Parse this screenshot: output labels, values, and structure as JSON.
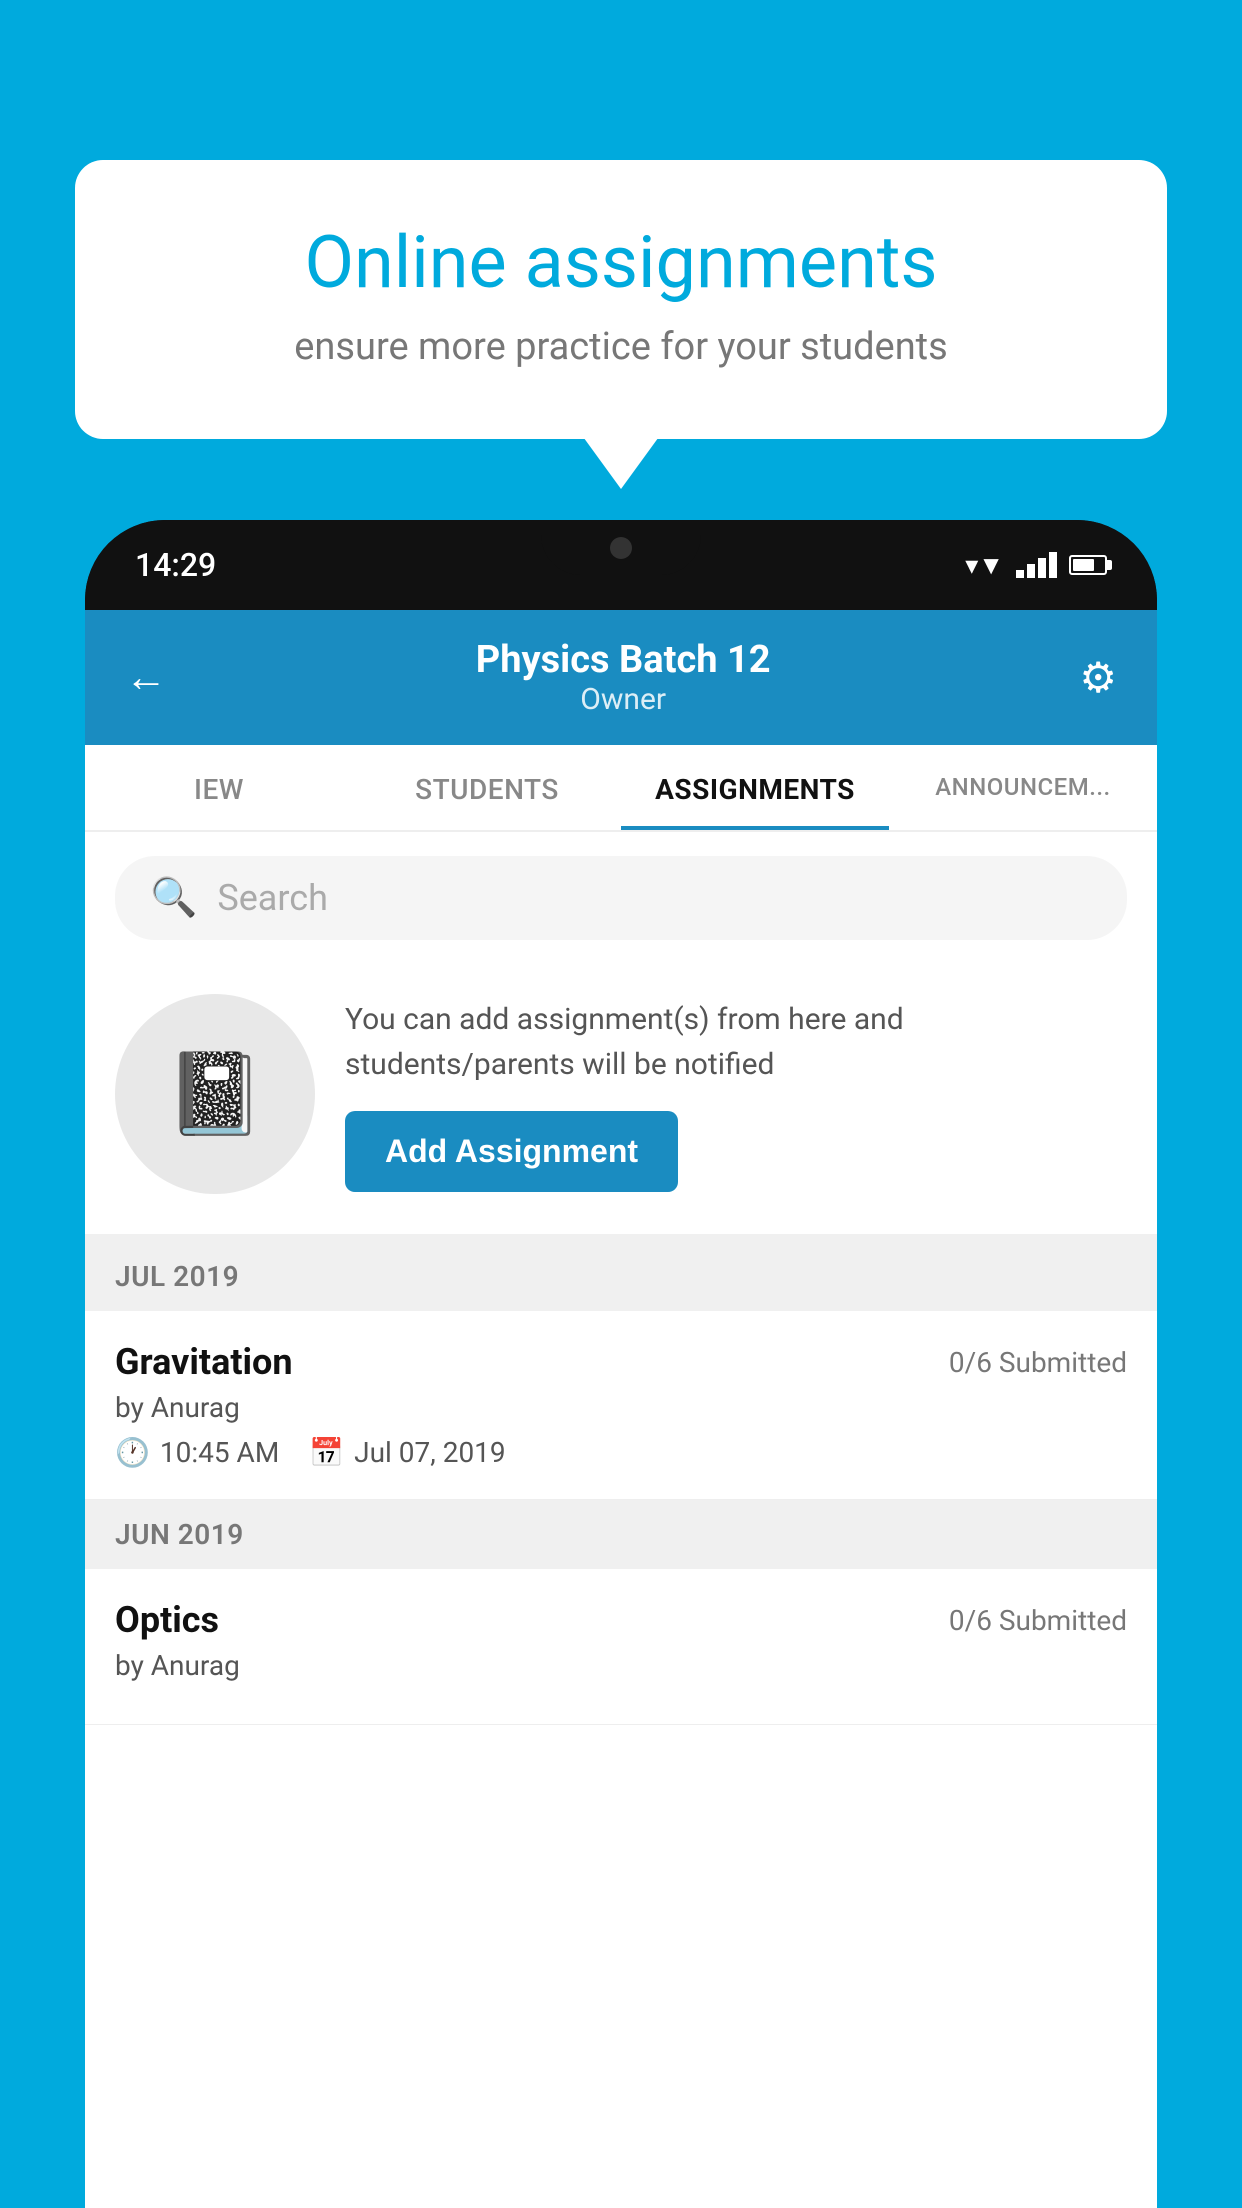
{
  "background_color": "#00AADD",
  "promo": {
    "title": "Online assignments",
    "subtitle": "ensure more practice for your students"
  },
  "phone": {
    "time": "14:29",
    "header": {
      "batch_name": "Physics Batch 12",
      "role": "Owner",
      "back_label": "←",
      "settings_label": "⚙"
    },
    "tabs": [
      {
        "label": "IEW",
        "active": false
      },
      {
        "label": "STUDENTS",
        "active": false
      },
      {
        "label": "ASSIGNMENTS",
        "active": true
      },
      {
        "label": "ANNOUNCEM...",
        "active": false
      }
    ],
    "search": {
      "placeholder": "Search"
    },
    "assignment_promo": {
      "description": "You can add assignment(s) from here and students/parents will be notified",
      "button_label": "Add Assignment"
    },
    "sections": [
      {
        "month": "JUL 2019",
        "assignments": [
          {
            "name": "Gravitation",
            "submitted": "0/6 Submitted",
            "by": "by Anurag",
            "time": "10:45 AM",
            "date": "Jul 07, 2019"
          }
        ]
      },
      {
        "month": "JUN 2019",
        "assignments": [
          {
            "name": "Optics",
            "submitted": "0/6 Submitted",
            "by": "by Anurag",
            "time": "",
            "date": ""
          }
        ]
      }
    ]
  }
}
